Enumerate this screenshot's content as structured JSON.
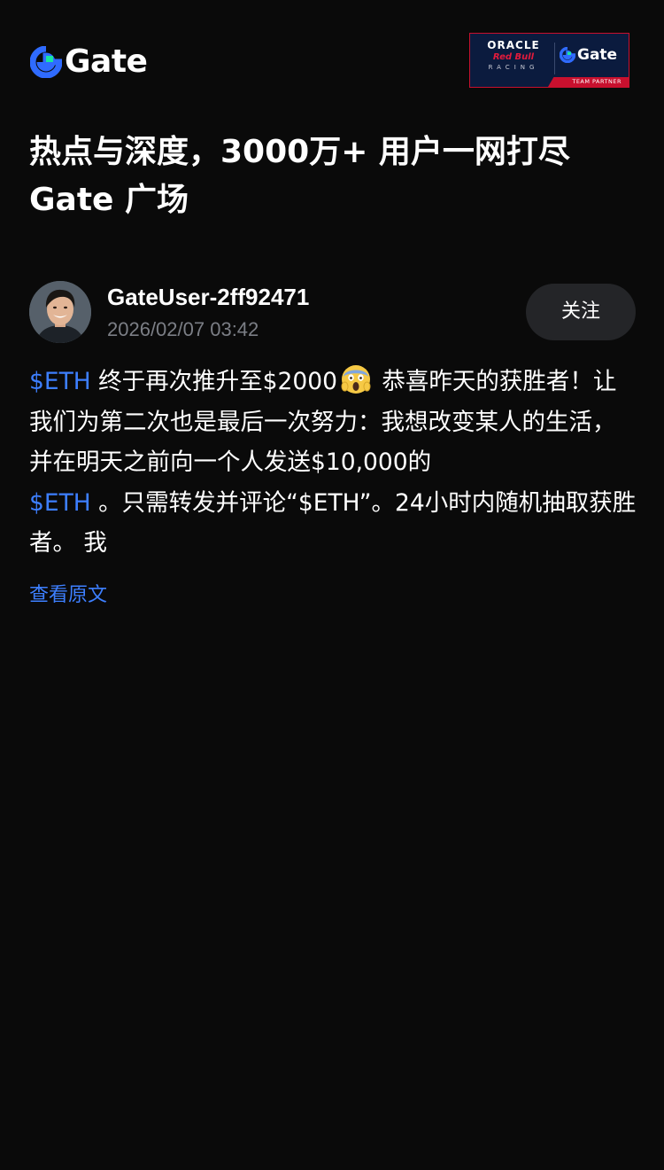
{
  "header": {
    "logo_text": "Gate",
    "partner_badge": {
      "line1": "ORACLE",
      "line2": "Red Bull",
      "line3": "RACING",
      "brand": "Gate",
      "strip": "TEAM PARTNER"
    }
  },
  "headline": {
    "line1": "热点与深度，3000万+ 用户一网打尽",
    "line2": "Gate 广场"
  },
  "post": {
    "author": "GateUser-2ff92471",
    "timestamp": "2026/02/07 03:42",
    "follow_label": "关注",
    "body": {
      "tag1": "$ETH",
      "text1": " 终于再次推升至$2000",
      "emoji": "screaming-face-emoji",
      "text2": " 恭喜昨天的获胜者！让我们为第二次也是最后一次努力：我想改变某人的生活，并在明天之前向一个人发送$10,000的",
      "tag2": "$ETH",
      "text3": " 。只需转发并评论“$ETH”。24小时内随机抽取获胜者。 我"
    },
    "view_original_label": "查看原文"
  },
  "colors": {
    "background": "#0a0a0a",
    "accent_blue": "#3d7fff",
    "logo_green": "#17e5a1",
    "muted_text": "#7b7e85",
    "button_bg": "#242528"
  }
}
